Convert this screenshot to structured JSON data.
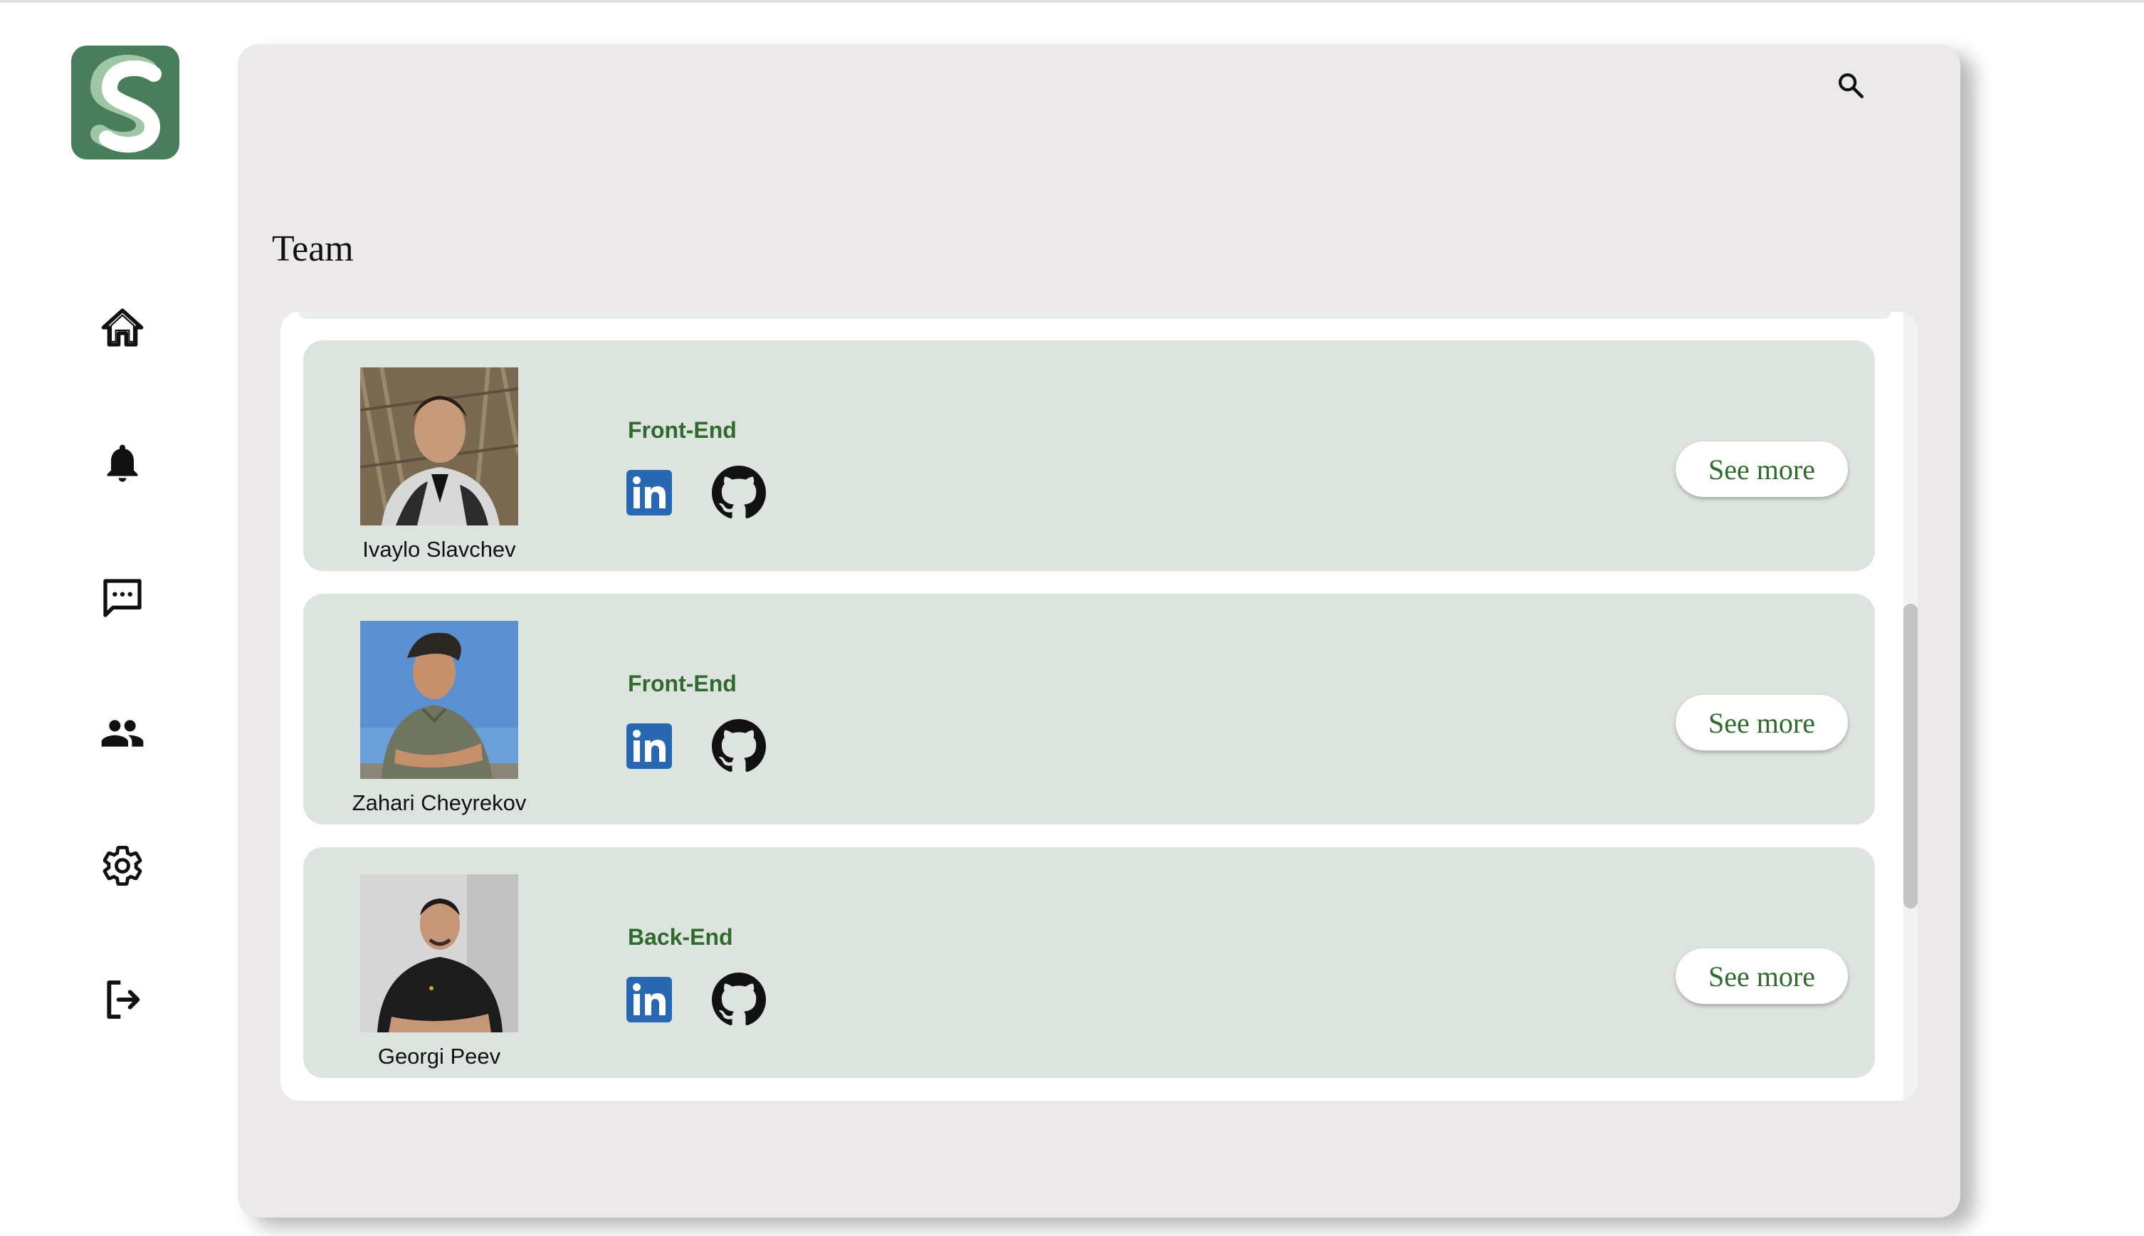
{
  "app": {
    "accent": "#2e6b2c",
    "logo_color": "#4a7d5b",
    "logo_letter": "S"
  },
  "sidebar": {
    "items": [
      {
        "id": "home",
        "icon": "home-icon"
      },
      {
        "id": "notifications",
        "icon": "bell-icon"
      },
      {
        "id": "messages",
        "icon": "chat-icon"
      },
      {
        "id": "team",
        "icon": "people-icon"
      },
      {
        "id": "settings",
        "icon": "gear-icon"
      },
      {
        "id": "logout",
        "icon": "logout-icon"
      }
    ]
  },
  "header": {
    "search_icon": "search-icon"
  },
  "page": {
    "title": "Team"
  },
  "members": [
    {
      "name": "Ivaylo Slavchev",
      "role": "Front-End",
      "see_more_label": "See more",
      "linkedin_icon": "linkedin-icon",
      "github_icon": "github-icon"
    },
    {
      "name": "Zahari Cheyrekov",
      "role": "Front-End",
      "see_more_label": "See more",
      "linkedin_icon": "linkedin-icon",
      "github_icon": "github-icon"
    },
    {
      "name": "Georgi Peev",
      "role": "Back-End",
      "see_more_label": "See more",
      "linkedin_icon": "linkedin-icon",
      "github_icon": "github-icon"
    }
  ]
}
